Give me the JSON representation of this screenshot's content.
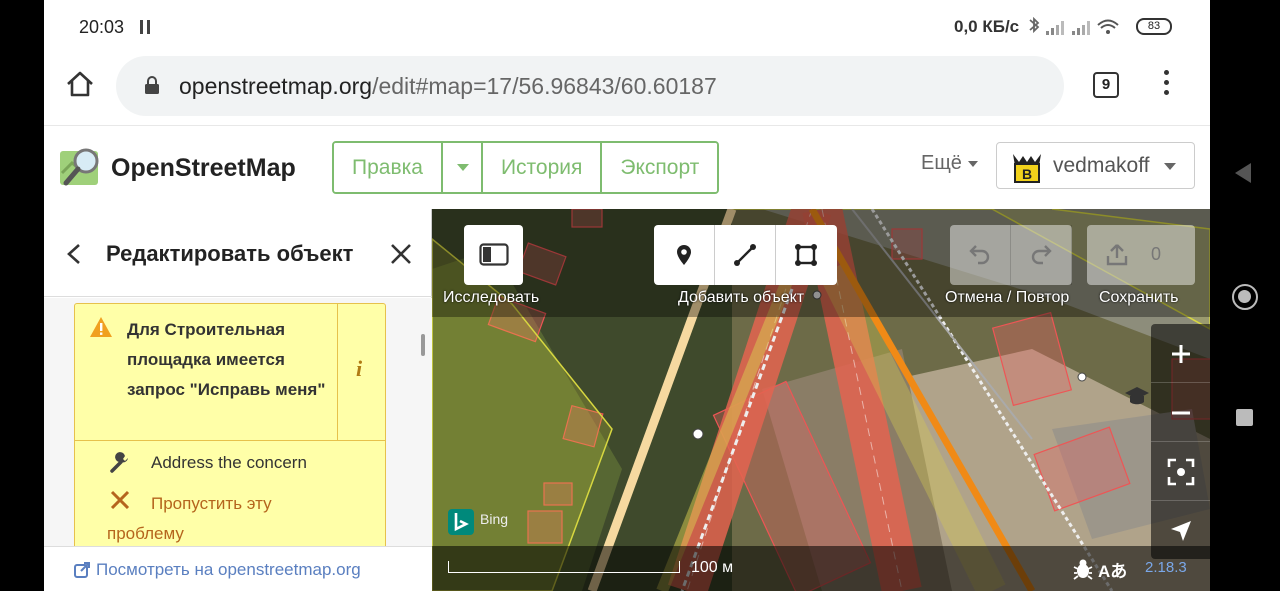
{
  "status": {
    "time": "20:03",
    "net_speed": "0,0 КБ/с",
    "battery": "83"
  },
  "browser": {
    "url_host": "openstreetmap.org",
    "url_path": "/edit#map=17/56.96843/60.60187",
    "tab_count": "9"
  },
  "header": {
    "site_title": "OpenStreetMap",
    "nav": {
      "edit": "Правка",
      "history": "История",
      "export": "Экспорт"
    },
    "more": "Ещё",
    "user": "vedmakoff"
  },
  "sidebar": {
    "title": "Редактировать объект",
    "issue": {
      "message": "Для Строительная площадка имеется запрос \"Исправь меня\"",
      "info_icon": "i",
      "fixes": [
        {
          "icon": "wrench-icon",
          "label": "Address the concern"
        },
        {
          "icon": "x-icon",
          "label": "Пропустить эту проблему"
        }
      ]
    },
    "footer_link": "Посмотреть на openstreetmap.org"
  },
  "map": {
    "explore_label": "Исследовать",
    "add_feature_label": "Добавить объект",
    "undo_redo_label": "Отмена / Повтор",
    "save_label": "Сохранить",
    "save_count": "0",
    "scale_label": "100 м",
    "imagery_credit": "Bing",
    "version": "2.18.3",
    "lang_icon_text": "Aあ"
  },
  "colors": {
    "osm_green": "#7ebc6f",
    "issue_bg": "#ffffa8",
    "issue_border": "#e6c14c",
    "link_blue": "#5a7fc0",
    "skip_brown": "#b5651d"
  }
}
